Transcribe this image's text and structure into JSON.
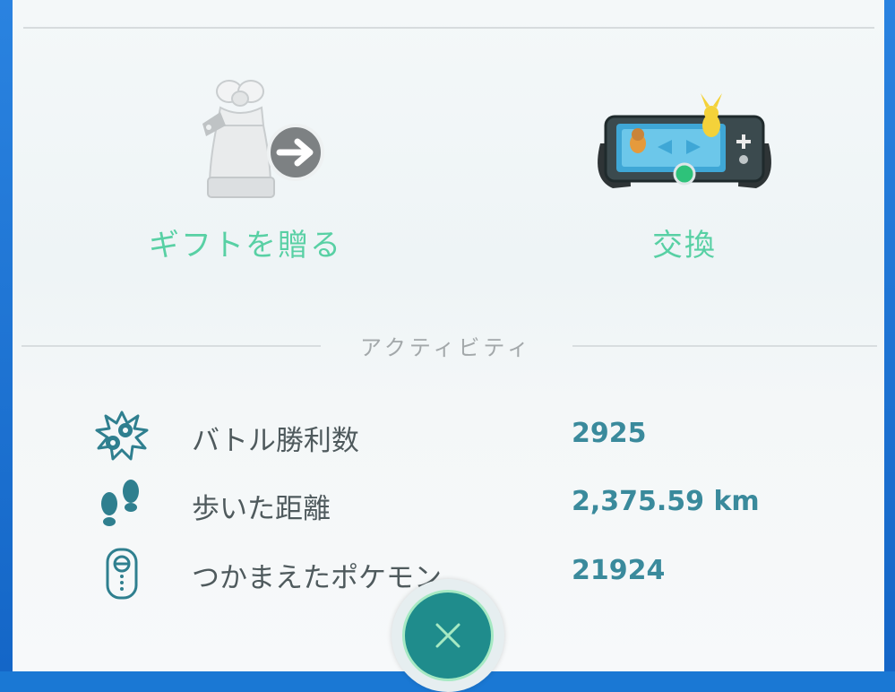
{
  "actions": {
    "gift_label": "ギフトを贈る",
    "trade_label": "交換"
  },
  "activity": {
    "header": "アクティビティ",
    "stats": [
      {
        "icon": "battle-icon",
        "label": "バトル勝利数",
        "value": "2925"
      },
      {
        "icon": "footprints-icon",
        "label": "歩いた距離",
        "value": "2,375.59 km"
      },
      {
        "icon": "pokedex-device-icon",
        "label": "つかまえたポケモン",
        "value": "21924"
      }
    ]
  },
  "colors": {
    "action_label": "#58d0a4",
    "stat_value": "#3a8a9c",
    "close_button": "#1f8c8c",
    "frame": "#1a78d4"
  },
  "close_button": {
    "icon": "close-icon"
  }
}
